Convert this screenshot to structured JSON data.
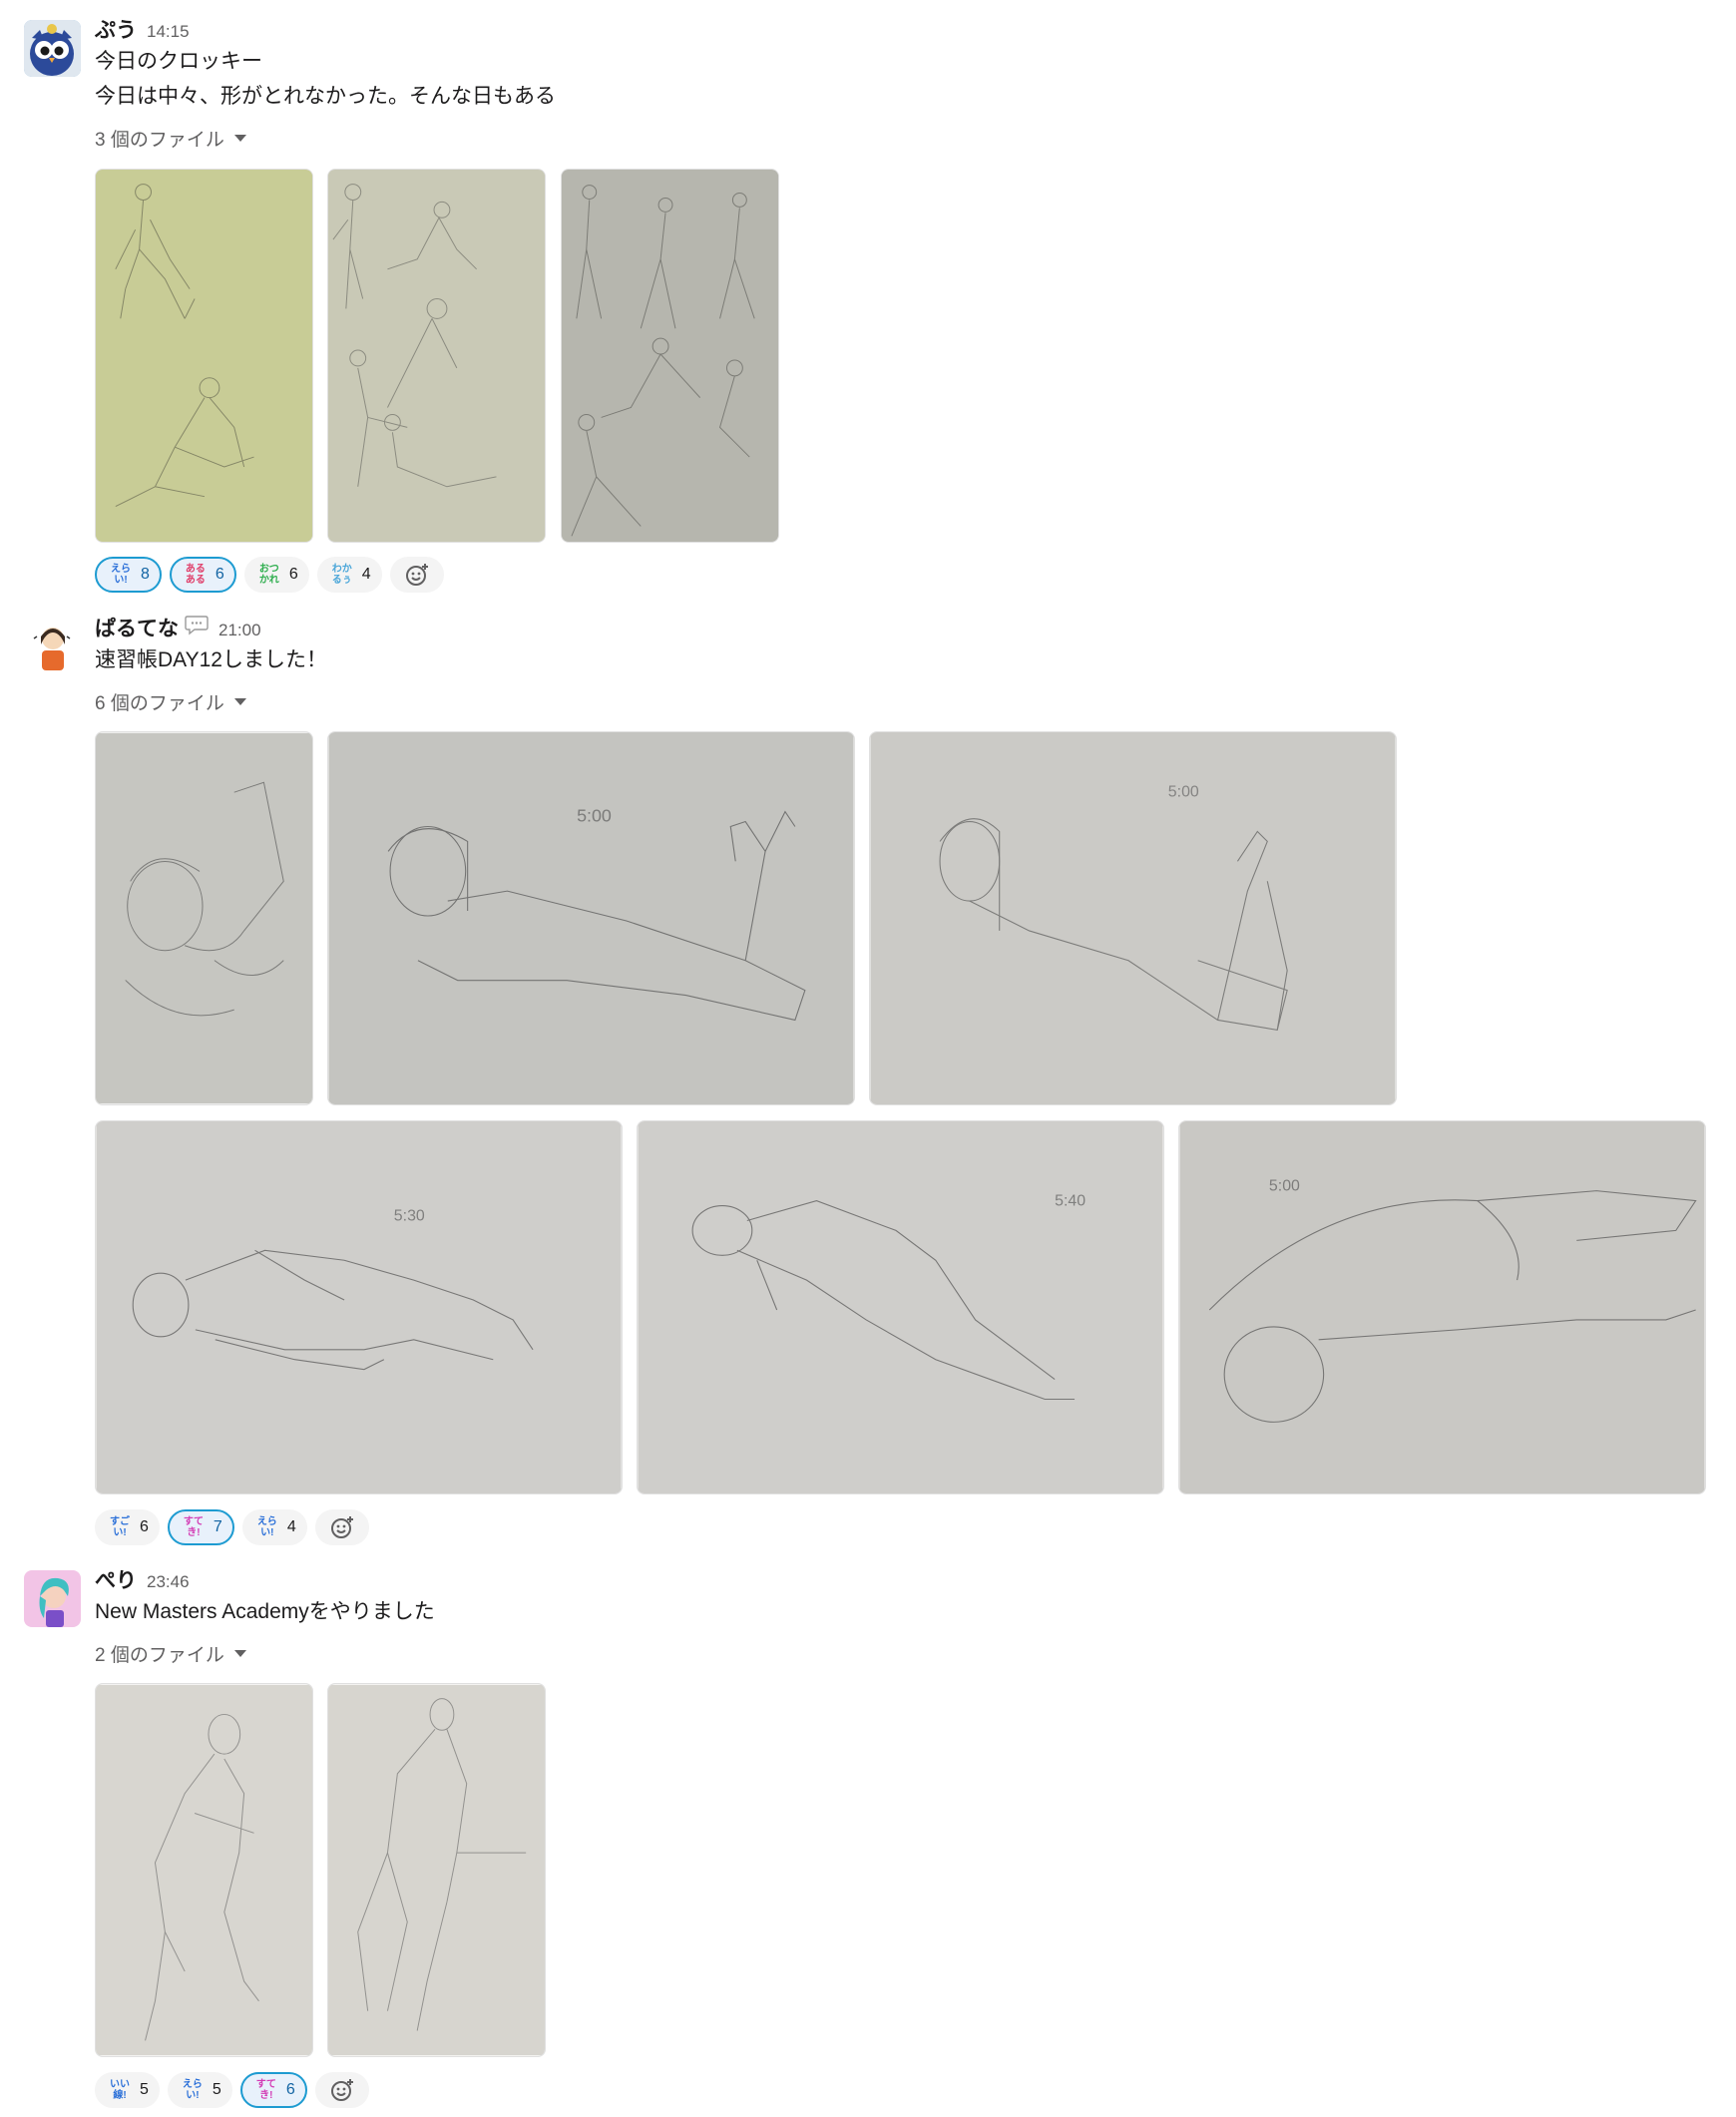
{
  "messages": [
    {
      "username": "ぷう",
      "time": "14:15",
      "lines": [
        "今日のクロッキー",
        "今日は中々、形がとれなかった。そんな日もある"
      ],
      "files_label": "3 個のファイル",
      "images": [
        {
          "desc": "figure-sketch-1",
          "tone": "#c8cc96"
        },
        {
          "desc": "figure-sketch-2",
          "tone": "#c9c9b6"
        },
        {
          "desc": "figure-sketch-3",
          "tone": "#b6b6ae"
        }
      ],
      "reactions": [
        {
          "emoji_text": [
            "えら",
            "い!"
          ],
          "emoji_color": "#2a6fd8",
          "count": "8",
          "active": true
        },
        {
          "emoji_text": [
            "ある",
            "ある"
          ],
          "emoji_color": "#e0406b",
          "count": "6",
          "active": true
        },
        {
          "emoji_text": [
            "おつ",
            "かれ"
          ],
          "emoji_color": "#2fae4e",
          "count": "6",
          "active": false
        },
        {
          "emoji_text": [
            "わか",
            "るぅ"
          ],
          "emoji_color": "#4aa6d9",
          "count": "4",
          "active": false
        }
      ]
    },
    {
      "username": "ぱるてな",
      "time": "21:00",
      "lines": [
        "速習帳DAY12しました！"
      ],
      "files_label": "6 個のファイル",
      "images": [
        {
          "desc": "lying-pose-1",
          "tone": "#c6c6c1"
        },
        {
          "desc": "lying-pose-2",
          "tone": "#c4c4c0"
        },
        {
          "desc": "lying-pose-3",
          "tone": "#cbcac6"
        },
        {
          "desc": "lying-pose-4",
          "tone": "#cfcecb"
        },
        {
          "desc": "lying-pose-5",
          "tone": "#cfcecb"
        },
        {
          "desc": "lying-pose-6",
          "tone": "#c9c8c4"
        }
      ],
      "reactions": [
        {
          "emoji_text": [
            "すご",
            "い!"
          ],
          "emoji_color": "#2a6fd8",
          "count": "6",
          "active": false
        },
        {
          "emoji_text": [
            "すて",
            "き!"
          ],
          "emoji_color": "#d33cb5",
          "count": "7",
          "active": true
        },
        {
          "emoji_text": [
            "えら",
            "い!"
          ],
          "emoji_color": "#2a6fd8",
          "count": "4",
          "active": false
        }
      ]
    },
    {
      "username": "ぺり",
      "time": "23:46",
      "lines": [
        "New Masters Academyをやりました"
      ],
      "files_label": "2 個のファイル",
      "images": [
        {
          "desc": "figure-study-1",
          "tone": "#d8d6d0"
        },
        {
          "desc": "figure-study-2",
          "tone": "#d7d5cf"
        }
      ],
      "reactions": [
        {
          "emoji_text": [
            "いい",
            "線!"
          ],
          "emoji_color": "#2a6fd8",
          "count": "5",
          "active": false
        },
        {
          "emoji_text": [
            "えら",
            "い!"
          ],
          "emoji_color": "#2a6fd8",
          "count": "5",
          "active": false
        },
        {
          "emoji_text": [
            "すて",
            "き!"
          ],
          "emoji_color": "#d33cb5",
          "count": "6",
          "active": true
        }
      ]
    }
  ],
  "icons": {
    "add_reaction": "add-reaction-icon",
    "caret": "caret-down-icon",
    "status": "speech-bubble-icon"
  },
  "colors": {
    "link_active": "#1264a3",
    "active_border": "#1d9bd1",
    "timestamp": "#616061"
  }
}
